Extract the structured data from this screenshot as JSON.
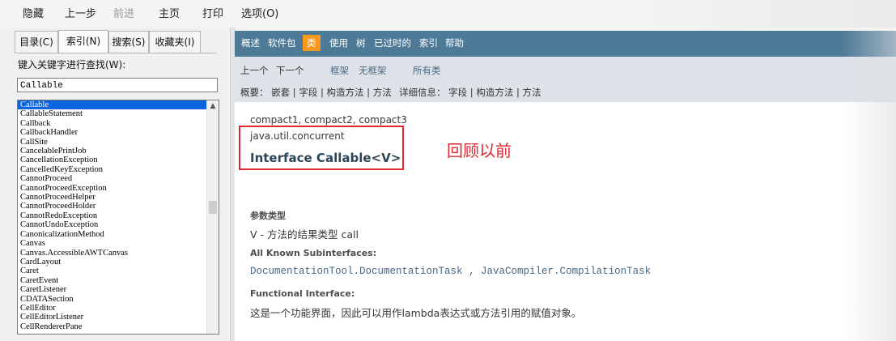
{
  "toolbar": {
    "items": [
      "隐藏",
      "上一步",
      "前进",
      "主页",
      "打印",
      "选项(O)"
    ]
  },
  "left": {
    "tabs": [
      "目录(C)",
      "索引(N)",
      "搜索(S)",
      "收藏夹(I)"
    ],
    "find_label": "键入关键字进行查找(W):",
    "search_value": "Callable",
    "list": [
      "Callable",
      "CallableStatement",
      "Callback",
      "CallbackHandler",
      "CallSite",
      "CancelablePrintJob",
      "CancellationException",
      "CancelledKeyException",
      "CannotProceed",
      "CannotProceedException",
      "CannotProceedHelper",
      "CannotProceedHolder",
      "CannotRedoException",
      "CannotUndoException",
      "CanonicalizationMethod",
      "Canvas",
      "Canvas.AccessibleAWTCanvas",
      "CardLayout",
      "Caret",
      "CaretEvent",
      "CaretListener",
      "CDATASection",
      "CellEditor",
      "CellEditorListener",
      "CellRendererPane"
    ],
    "selected_index": 0
  },
  "nav": {
    "items": [
      "概述",
      "软件包",
      "类",
      "使用",
      "树",
      "已过时的",
      "索引",
      "帮助"
    ],
    "active_index": 2
  },
  "subnav": {
    "prev": "上一个",
    "next": "下一个",
    "frames": "框架",
    "noframes": "无框架",
    "allclasses": "所有类",
    "summary": "概要： 嵌套 | 字段 | 构造方法 | 方法",
    "detail": "详细信息： 字段 | 构造方法 | 方法"
  },
  "content": {
    "profiles": "compact1, compact2, compact3",
    "package": "java.util.concurrent",
    "title": "Interface Callable<V>",
    "annotation": "回顾以前",
    "type_params_label": "参数类型",
    "type_param": "V - 方法的结果类型 call",
    "subinterfaces_label": "All Known Subinterfaces:",
    "subinterfaces": "DocumentationTool.DocumentationTask , JavaCompiler.CompilationTask",
    "functional_label": "Functional Interface:",
    "functional_desc": "这是一个功能界面，因此可以用作lambda表达式或方法引用的赋值对象。"
  },
  "colors": {
    "nav_bg": "#4d7a97",
    "nav_active": "#f8981d",
    "subnav_bg": "#dee3e9",
    "annotation_red": "#e0282f",
    "selection": "#0a64e0"
  }
}
